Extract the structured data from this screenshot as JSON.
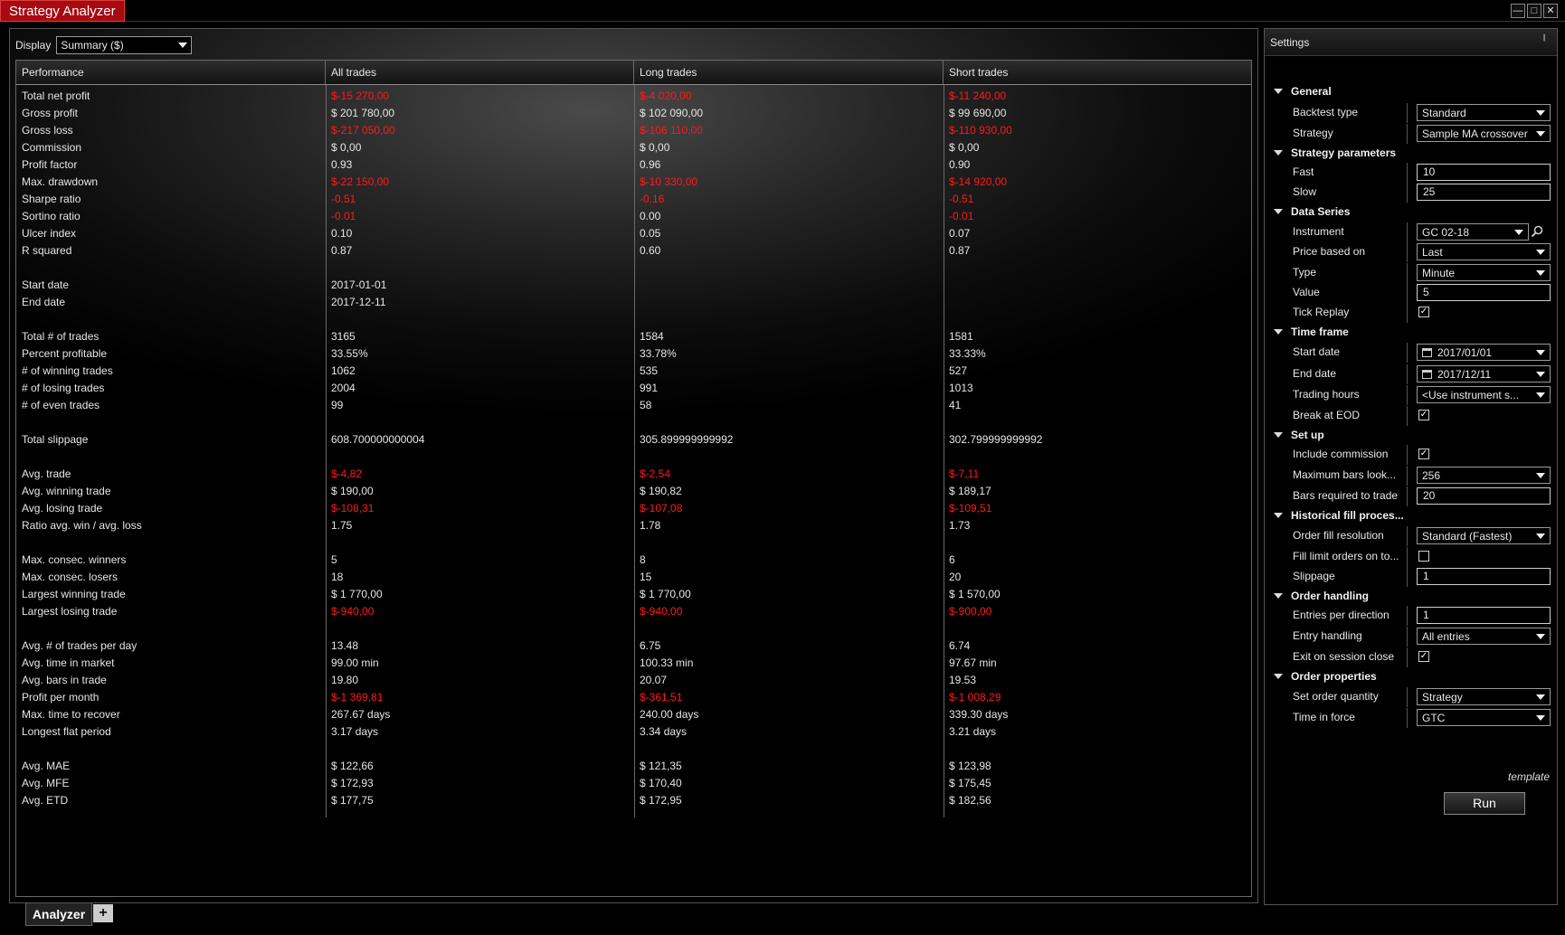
{
  "window": {
    "title": "Strategy Analyzer"
  },
  "display": {
    "label": "Display",
    "value": "Summary ($)"
  },
  "table": {
    "headers": [
      "Performance",
      "All trades",
      "Long trades",
      "Short trades"
    ],
    "rows": [
      [
        "Total net profit",
        "$-15 270,00",
        "$-4 020,00",
        "$-11 240,00"
      ],
      [
        "Gross profit",
        "$ 201 780,00",
        "$ 102 090,00",
        "$ 99 690,00"
      ],
      [
        "Gross loss",
        "$-217 050,00",
        "$-106 110,00",
        "$-110 930,00"
      ],
      [
        "Commission",
        "$ 0,00",
        "$ 0,00",
        "$ 0,00"
      ],
      [
        "Profit factor",
        "0.93",
        "0.96",
        "0.90"
      ],
      [
        "Max. drawdown",
        "$-22 150,00",
        "$-10 330,00",
        "$-14 920,00"
      ],
      [
        "Sharpe ratio",
        "-0.51",
        "-0.16",
        "-0.51"
      ],
      [
        "Sortino ratio",
        "-0.01",
        "0.00",
        "-0.01"
      ],
      [
        "Ulcer index",
        "0.10",
        "0.05",
        "0.07"
      ],
      [
        "R squared",
        "0.87",
        "0.60",
        "0.87"
      ],
      [
        "",
        "",
        "",
        ""
      ],
      [
        "Start date",
        "2017-01-01",
        "",
        ""
      ],
      [
        "End date",
        "2017-12-11",
        "",
        ""
      ],
      [
        "",
        "",
        "",
        ""
      ],
      [
        "Total # of trades",
        "3165",
        "1584",
        "1581"
      ],
      [
        "Percent profitable",
        "33.55%",
        "33.78%",
        "33.33%"
      ],
      [
        "# of winning trades",
        "1062",
        "535",
        "527"
      ],
      [
        "# of losing trades",
        "2004",
        "991",
        "1013"
      ],
      [
        "# of even trades",
        "99",
        "58",
        "41"
      ],
      [
        "",
        "",
        "",
        ""
      ],
      [
        "Total slippage",
        "608.700000000004",
        "305.899999999992",
        "302.799999999992"
      ],
      [
        "",
        "",
        "",
        ""
      ],
      [
        "Avg. trade",
        "$-4,82",
        "$-2,54",
        "$-7,11"
      ],
      [
        "Avg. winning trade",
        "$ 190,00",
        "$ 190,82",
        "$ 189,17"
      ],
      [
        "Avg. losing trade",
        "$-108,31",
        "$-107,08",
        "$-109,51"
      ],
      [
        "Ratio avg. win / avg. loss",
        "1.75",
        "1.78",
        "1.73"
      ],
      [
        "",
        "",
        "",
        ""
      ],
      [
        "Max. consec. winners",
        "5",
        "8",
        "6"
      ],
      [
        "Max. consec. losers",
        "18",
        "15",
        "20"
      ],
      [
        "Largest winning trade",
        "$ 1 770,00",
        "$ 1 770,00",
        "$ 1 570,00"
      ],
      [
        "Largest losing trade",
        "$-940,00",
        "$-940,00",
        "$-900,00"
      ],
      [
        "",
        "",
        "",
        ""
      ],
      [
        "Avg. # of trades per day",
        "13.48",
        "6.75",
        "6.74"
      ],
      [
        "Avg. time in market",
        "99.00 min",
        "100.33 min",
        "97.67 min"
      ],
      [
        "Avg. bars in trade",
        "19.80",
        "20.07",
        "19.53"
      ],
      [
        "Profit per month",
        "$-1 369,81",
        "$-361,51",
        "$-1 008,29"
      ],
      [
        "Max. time to recover",
        "267.67 days",
        "240.00 days",
        "339.30 days"
      ],
      [
        "Longest flat period",
        "3.17 days",
        "3.34 days",
        "3.21 days"
      ],
      [
        "",
        "",
        "",
        ""
      ],
      [
        "Avg. MAE",
        "$ 122,66",
        "$ 121,35",
        "$ 123,98"
      ],
      [
        "Avg. MFE",
        "$ 172,93",
        "$ 170,40",
        "$ 175,45"
      ],
      [
        "Avg. ETD",
        "$ 177,75",
        "$ 172,95",
        "$ 182,56"
      ]
    ]
  },
  "tabs": {
    "analyzer": "Analyzer",
    "add": "+"
  },
  "settings": {
    "title": "Settings",
    "items": [
      {
        "kind": "cat",
        "label": "General"
      },
      {
        "kind": "select",
        "label": "Backtest type",
        "value": "Standard"
      },
      {
        "kind": "select",
        "label": "Strategy",
        "value": "Sample MA crossover"
      },
      {
        "kind": "cat",
        "label": "Strategy parameters"
      },
      {
        "kind": "input",
        "label": "Fast",
        "value": "10"
      },
      {
        "kind": "input",
        "label": "Slow",
        "value": "25"
      },
      {
        "kind": "cat",
        "label": "Data Series"
      },
      {
        "kind": "instrument",
        "label": "Instrument",
        "value": "GC 02-18"
      },
      {
        "kind": "select",
        "label": "Price based on",
        "value": "Last"
      },
      {
        "kind": "select",
        "label": "Type",
        "value": "Minute"
      },
      {
        "kind": "input",
        "label": "Value",
        "value": "5"
      },
      {
        "kind": "check",
        "label": "Tick Replay",
        "checked": true
      },
      {
        "kind": "cat",
        "label": "Time frame"
      },
      {
        "kind": "date",
        "label": "Start date",
        "value": "2017/01/01"
      },
      {
        "kind": "date",
        "label": "End date",
        "value": "2017/12/11"
      },
      {
        "kind": "select",
        "label": "Trading hours",
        "value": "<Use instrument s..."
      },
      {
        "kind": "check",
        "label": "Break at EOD",
        "checked": true
      },
      {
        "kind": "cat",
        "label": "Set up"
      },
      {
        "kind": "check",
        "label": "Include commission",
        "checked": true
      },
      {
        "kind": "select",
        "label": "Maximum bars look...",
        "value": "256"
      },
      {
        "kind": "input",
        "label": "Bars required to trade",
        "value": "20"
      },
      {
        "kind": "cat",
        "label": "Historical fill proces..."
      },
      {
        "kind": "select",
        "label": "Order fill resolution",
        "value": "Standard (Fastest)"
      },
      {
        "kind": "check",
        "label": "Fill limit orders on to...",
        "checked": false
      },
      {
        "kind": "input",
        "label": "Slippage",
        "value": "1"
      },
      {
        "kind": "cat",
        "label": "Order handling"
      },
      {
        "kind": "input",
        "label": "Entries per direction",
        "value": "1"
      },
      {
        "kind": "select",
        "label": "Entry handling",
        "value": "All entries"
      },
      {
        "kind": "check",
        "label": "Exit on session close",
        "checked": true
      },
      {
        "kind": "cat",
        "label": "Order properties"
      },
      {
        "kind": "select",
        "label": "Set order quantity",
        "value": "Strategy"
      },
      {
        "kind": "select",
        "label": "Time in force",
        "value": "GTC"
      }
    ],
    "template_link": "template",
    "run_label": "Run"
  },
  "colors": {
    "title_bg": "#a80a12",
    "negative": "#ff1a1a",
    "text": "#e6e6e6"
  }
}
